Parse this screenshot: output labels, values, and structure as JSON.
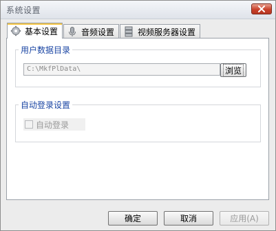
{
  "window": {
    "title": "系统设置"
  },
  "tabs": [
    {
      "label": "基本设置",
      "icon": "gear-icon",
      "active": true
    },
    {
      "label": "音频设置",
      "icon": "microphone-icon",
      "active": false
    },
    {
      "label": "视频服务器设置",
      "icon": "server-icon",
      "active": false
    }
  ],
  "user_data": {
    "group_title": "用户数据目录",
    "path_value": "C:\\MkfPlData\\",
    "browse_label": "浏览"
  },
  "auto_login": {
    "group_title": "自动登录设置",
    "checkbox_label": "自动登录",
    "checked": false
  },
  "buttons": {
    "ok": "确定",
    "cancel": "取消",
    "apply": "应用(A)"
  },
  "colors": {
    "group_title": "#1a45a3",
    "close_button": "#c9412b",
    "active_tab_accent": "#f5c542"
  }
}
